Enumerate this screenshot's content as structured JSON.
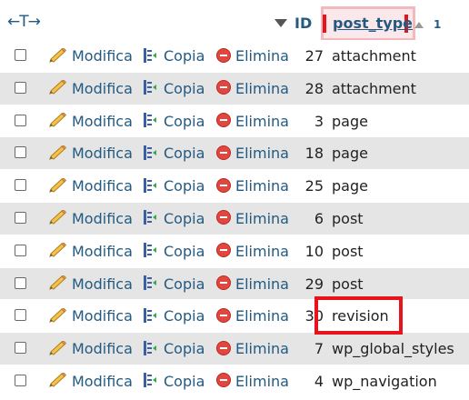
{
  "header": {
    "arrows": "←T→",
    "id_label": "ID",
    "post_type_label": "post_type",
    "sort_order": "1"
  },
  "actions": {
    "edit_label": "Modifica",
    "copy_label": "Copia",
    "delete_label": "Elimina"
  },
  "rows": [
    {
      "id": "27",
      "post_type": "attachment"
    },
    {
      "id": "28",
      "post_type": "attachment"
    },
    {
      "id": "3",
      "post_type": "page"
    },
    {
      "id": "18",
      "post_type": "page"
    },
    {
      "id": "25",
      "post_type": "page"
    },
    {
      "id": "6",
      "post_type": "post"
    },
    {
      "id": "10",
      "post_type": "post"
    },
    {
      "id": "29",
      "post_type": "post"
    },
    {
      "id": "30",
      "post_type": "revision"
    },
    {
      "id": "7",
      "post_type": "wp_global_styles"
    },
    {
      "id": "4",
      "post_type": "wp_navigation"
    }
  ],
  "colors": {
    "link": "#235a81",
    "highlight_red": "#e8141c",
    "header_highlight": "#f2b8bd",
    "row_alt": "#e5e5e5"
  }
}
